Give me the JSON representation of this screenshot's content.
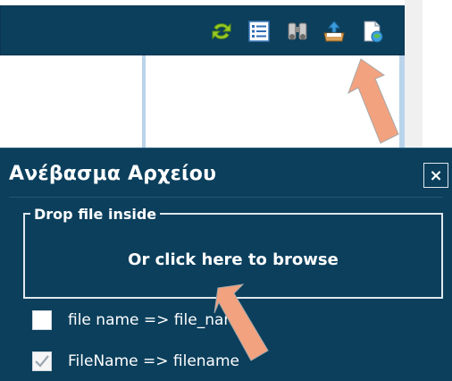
{
  "toolbar": {
    "icons": [
      "refresh-icon",
      "list-icon",
      "binoculars-icon",
      "upload-icon",
      "document-globe-icon"
    ]
  },
  "dialog": {
    "title": "Ανέβασμα Αρχείου",
    "close_label": "×",
    "dropzone": {
      "legend": "Drop file inside",
      "cta": "Or click here to browse"
    },
    "options": [
      {
        "label": "file name => file_name",
        "checked": false
      },
      {
        "label": "FileName => filename",
        "checked": true
      }
    ]
  },
  "colors": {
    "panel_bg": "#0b3f5c",
    "accent_arrow": "#f2a27f"
  }
}
